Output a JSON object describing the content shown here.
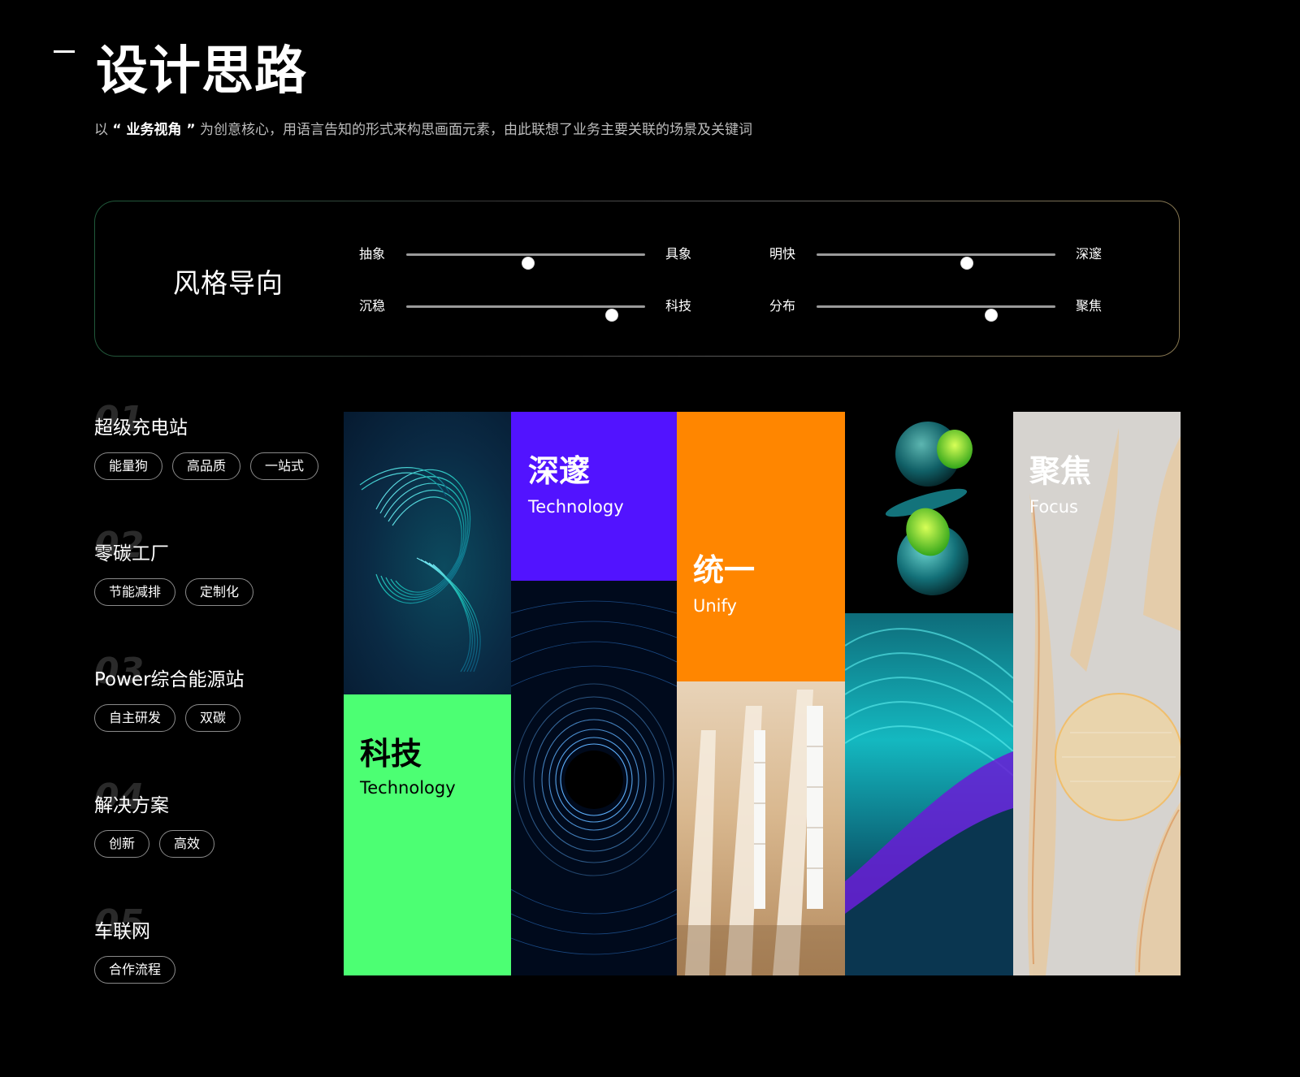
{
  "header": {
    "title": "设计思路",
    "subtitle_prefix": "以",
    "subtitle_highlight": "“ 业务视角 ”",
    "subtitle_rest": "为创意核心，用语言告知的形式来构思画面元素，由此联想了业务主要关联的场景及关键词"
  },
  "style_panel": {
    "title": "风格导向",
    "sliders": [
      {
        "left": "抽象",
        "right": "具象",
        "value": 0.51
      },
      {
        "left": "明快",
        "right": "深邃",
        "value": 0.63
      },
      {
        "left": "沉稳",
        "right": "科技",
        "value": 0.86
      },
      {
        "left": "分布",
        "right": "聚焦",
        "value": 0.73
      }
    ]
  },
  "categories": [
    {
      "num": "01",
      "name": "超级充电站",
      "tags": [
        "能量狗",
        "高品质",
        "一站式"
      ]
    },
    {
      "num": "02",
      "name": "零碳工厂",
      "tags": [
        "节能减排",
        "定制化"
      ]
    },
    {
      "num": "03",
      "name": "Power综合能源站",
      "tags": [
        "自主研发",
        "双碳"
      ]
    },
    {
      "num": "04",
      "name": "解决方案",
      "tags": [
        "创新",
        "高效"
      ]
    },
    {
      "num": "05",
      "name": "车联网",
      "tags": [
        "合作流程"
      ]
    }
  ],
  "moodboard": {
    "tiles": {
      "tech": {
        "zh": "科技",
        "en": "Technology",
        "color": "#4cff73"
      },
      "deep": {
        "zh": "深邃",
        "en": "Technology",
        "color": "#5213ff"
      },
      "unify": {
        "zh": "统一",
        "en": "Unify",
        "color": "#ff8600"
      },
      "focus": {
        "zh": "聚焦",
        "en": "Focus",
        "color": "#d6d3cf"
      }
    },
    "images": [
      "spiral-ribbon-image",
      "wire-vortex-image",
      "architecture-image",
      "glass-spheres-image",
      "neon-waves-image",
      "glass-petals-image"
    ]
  }
}
